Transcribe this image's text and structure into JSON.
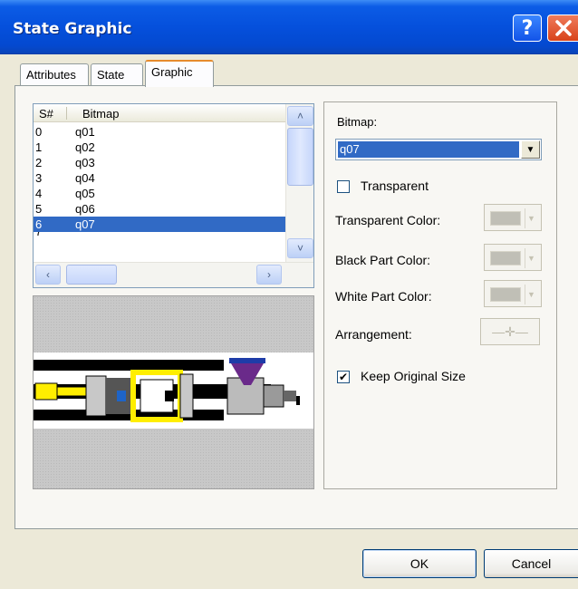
{
  "window": {
    "title": "State Graphic"
  },
  "tabs": [
    {
      "label": "Attributes"
    },
    {
      "label": "State"
    },
    {
      "label": "Graphic"
    }
  ],
  "list": {
    "headers": [
      "S#",
      "Bitmap"
    ],
    "rows": [
      {
        "s": "0",
        "bitmap": "q01"
      },
      {
        "s": "1",
        "bitmap": "q02"
      },
      {
        "s": "2",
        "bitmap": "q03"
      },
      {
        "s": "3",
        "bitmap": "q04"
      },
      {
        "s": "4",
        "bitmap": "q05"
      },
      {
        "s": "5",
        "bitmap": "q06"
      },
      {
        "s": "6",
        "bitmap": "q07"
      }
    ],
    "selected_index": 6
  },
  "props": {
    "bitmap_label": "Bitmap:",
    "bitmap_value": "q07",
    "transparent_label": "Transparent",
    "transparent_checked": false,
    "transparent_color_label": "Transparent Color:",
    "black_part_color_label": "Black Part Color:",
    "white_part_color_label": "White Part Color:",
    "arrangement_label": "Arrangement:",
    "keep_size_label": "Keep Original Size",
    "keep_size_checked": true
  },
  "buttons": {
    "ok": "OK",
    "cancel": "Cancel"
  },
  "icons": {
    "help": "help-icon",
    "close": "close-icon"
  },
  "colors": {
    "selection": "#316ac5",
    "titlebar": "#0550dc",
    "accent_yellow": "#ffff00",
    "hopper": "#6a2a8a"
  }
}
